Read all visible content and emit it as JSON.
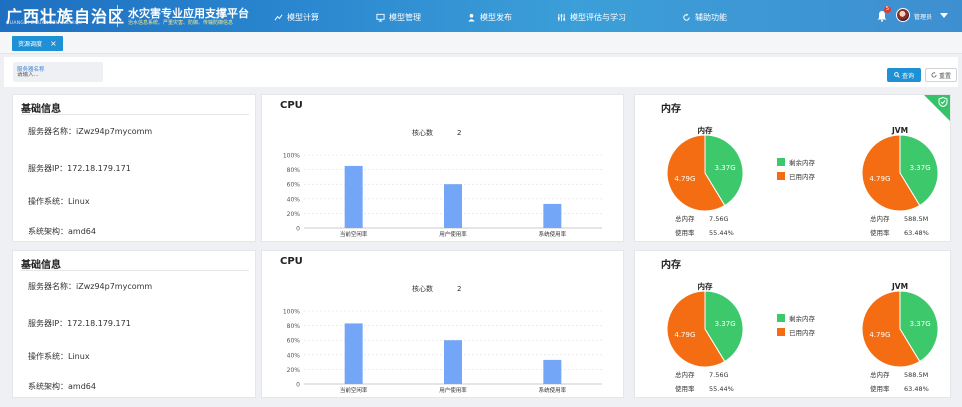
{
  "header": {
    "logo_main": "广西壮族自治区",
    "logo_sub": "GUANGXI ZHUANGZU ZIZHIQU",
    "platform_title": "水灾害专业应用支撑平台",
    "platform_sub": "治水信息系统、严重灾害、防御、传输防御信息",
    "nav": [
      {
        "label": "模型计算",
        "icon": "chart-icon"
      },
      {
        "label": "模型管理",
        "icon": "screen-icon"
      },
      {
        "label": "模型发布",
        "icon": "person-icon"
      },
      {
        "label": "模型评估与学习",
        "icon": "sliders-icon"
      },
      {
        "label": "辅助功能",
        "icon": "cycle-icon"
      }
    ],
    "notification_count": "5",
    "user_name": "管理员"
  },
  "tabs": [
    {
      "label": "资源调度"
    }
  ],
  "search": {
    "label": "服务器名称",
    "placeholder": "请输入...",
    "query_label": "查询",
    "reset_label": "重置"
  },
  "servers": [
    {
      "info_title": "基础信息",
      "name_line": "服务器名称：iZwz94p7mycomm",
      "ip_line": "服务器IP：172.18.179.171",
      "os_line": "操作系统：Linux",
      "arch_line": "系统架构：amd64",
      "cpu": {
        "title": "CPU",
        "cores_label": "核心数",
        "cores": "2",
        "chart_data": {
          "type": "bar",
          "categories": [
            "当前空闲率",
            "用户使用率",
            "系统使用率"
          ],
          "values": [
            85,
            60,
            33
          ],
          "ylim": [
            0,
            100
          ],
          "yticks": [
            "100%",
            "80%",
            "60%",
            "40%",
            "20%",
            "0"
          ]
        }
      },
      "memory": {
        "title": "内存",
        "legend": [
          "剩余内存",
          "已用内存"
        ],
        "charts": [
          {
            "title": "内存",
            "chart_data": {
              "type": "pie",
              "labels": [
                "剩余内存",
                "已用内存"
              ],
              "values": [
                3.37,
                4.79
              ],
              "value_labels": [
                "3.37G",
                "4.79G"
              ]
            },
            "total_label": "总内存",
            "total": "7.56G",
            "usage_label": "使用率",
            "usage": "55.44%"
          },
          {
            "title": "JVM",
            "chart_data": {
              "type": "pie",
              "labels": [
                "剩余内存",
                "已用内存"
              ],
              "values": [
                3.37,
                4.79
              ],
              "value_labels": [
                "3.37G",
                "4.79G"
              ]
            },
            "total_label": "总内存",
            "total": "588.5M",
            "usage_label": "使用率",
            "usage": "63.48%"
          }
        ],
        "badge": true
      }
    },
    {
      "info_title": "基础信息",
      "name_line": "服务器名称：iZwz94p7mycomm",
      "ip_line": "服务器IP：172.18.179.171",
      "os_line": "操作系统：Linux",
      "arch_line": "系统架构：amd64",
      "cpu": {
        "title": "CPU",
        "cores_label": "核心数",
        "cores": "2",
        "chart_data": {
          "type": "bar",
          "categories": [
            "当前空闲率",
            "用户使用率",
            "系统使用率"
          ],
          "values": [
            83,
            60,
            33
          ],
          "ylim": [
            0,
            100
          ],
          "yticks": [
            "100%",
            "80%",
            "60%",
            "40%",
            "20%",
            "0"
          ]
        }
      },
      "memory": {
        "title": "内存",
        "legend": [
          "剩余内存",
          "已用内存"
        ],
        "charts": [
          {
            "title": "内存",
            "chart_data": {
              "type": "pie",
              "labels": [
                "剩余内存",
                "已用内存"
              ],
              "values": [
                3.37,
                4.79
              ],
              "value_labels": [
                "3.37G",
                "4.79G"
              ]
            },
            "total_label": "总内存",
            "total": "7.56G",
            "usage_label": "使用率",
            "usage": "55.44%"
          },
          {
            "title": "JVM",
            "chart_data": {
              "type": "pie",
              "labels": [
                "剩余内存",
                "已用内存"
              ],
              "values": [
                3.37,
                4.79
              ],
              "value_labels": [
                "3.37G",
                "4.79G"
              ]
            },
            "total_label": "总内存",
            "total": "588.5M",
            "usage_label": "使用率",
            "usage": "63.48%"
          }
        ],
        "badge": false
      }
    }
  ],
  "colors": {
    "accent": "#1e90d6",
    "bar": "#74a6f7",
    "free": "#3dc86b",
    "used": "#f46d12",
    "badge": "#36c26a"
  }
}
